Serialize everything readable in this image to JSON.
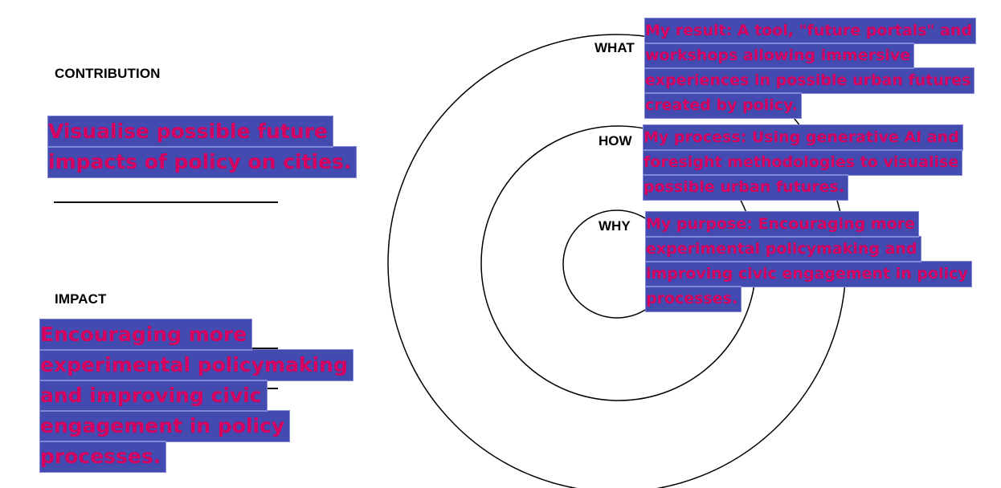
{
  "left_panel": {
    "contribution": {
      "heading": "CONTRIBUTION",
      "lines": [
        "Visualise possible future",
        "impacts of policy on cities."
      ]
    },
    "impact": {
      "heading": "IMPACT",
      "lines": [
        "Encouraging more",
        "experimental policymaking",
        "and improving civic",
        "engagement in policy",
        "processes."
      ]
    }
  },
  "golden_circle": {
    "rings": [
      {
        "label": "WHAT",
        "lines": [
          "My result: A tool, \"future portals\" and",
          "workshops allowing immersive",
          "experiences in possible urban futures",
          "created by policy."
        ]
      },
      {
        "label": "HOW",
        "lines": [
          "My process: Using generative AI and",
          "foresight methodologies to visualise",
          "possible urban futures."
        ]
      },
      {
        "label": "WHY",
        "lines": [
          "My purpose: Encouraging more",
          "experimental policymaking and",
          "improving civic engagement in policy",
          "processes."
        ]
      }
    ]
  },
  "colors": {
    "highlight_background": "#434bb0",
    "highlight_text": "#d6005f",
    "line_color": "#000000",
    "background": "#ffffff"
  }
}
